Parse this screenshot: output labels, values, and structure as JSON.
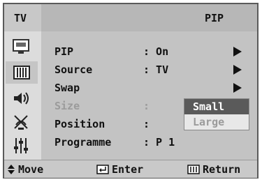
{
  "header": {
    "left_label": "TV",
    "title": "PIP"
  },
  "sidebar": {
    "icons": [
      {
        "name": "picture-icon"
      },
      {
        "name": "setup-icon",
        "active": true
      },
      {
        "name": "sound-icon"
      },
      {
        "name": "channel-icon"
      },
      {
        "name": "function-icon"
      }
    ]
  },
  "menu": {
    "rows": [
      {
        "label": "PIP",
        "value": ": On",
        "has_arrow": true
      },
      {
        "label": "Source",
        "value": ": TV",
        "has_arrow": true
      },
      {
        "label": "Swap",
        "value": "",
        "has_arrow": true
      },
      {
        "label": "Size",
        "value": ":",
        "has_arrow": true,
        "disabled": true
      },
      {
        "label": "Position",
        "value": ":",
        "has_arrow": true
      },
      {
        "label": "Programme",
        "value": ": P 1",
        "has_arrow": false
      }
    ]
  },
  "dropdown": {
    "selected": "Small",
    "other": "Large"
  },
  "footer": {
    "move": "Move",
    "enter": "Enter",
    "return": "Return"
  }
}
